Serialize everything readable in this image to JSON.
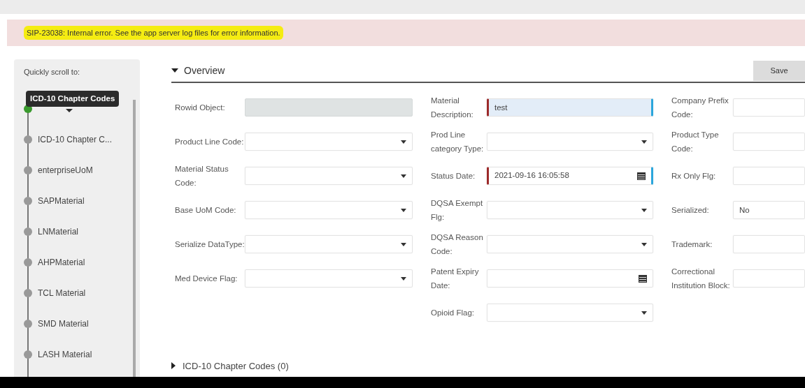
{
  "error_banner": {
    "text": "SIP-23038: Internal error. See the app server log files for error information.",
    "highlighted": true
  },
  "sidebar": {
    "title": "Quickly scroll to:",
    "tooltip": "ICD-10 Chapter Codes",
    "items": [
      {
        "selected": true
      },
      {
        "label": "ICD-10 Chapter C...",
        "selected": false
      },
      {
        "label": "enterpriseUoM",
        "selected": false
      },
      {
        "label": "SAPMaterial",
        "selected": false
      },
      {
        "label": "LNMaterial",
        "selected": false
      },
      {
        "label": "AHPMaterial",
        "selected": false
      },
      {
        "label": "TCL Material",
        "selected": false
      },
      {
        "label": "SMD Material",
        "selected": false
      },
      {
        "label": "LASH Material",
        "selected": false
      }
    ]
  },
  "section": {
    "title": "Overview",
    "expanded": true,
    "save_button": "Save",
    "columns": [
      [
        {
          "label": "Rowid Object:",
          "kind": "text",
          "disabled": true,
          "required": false,
          "focused": false
        },
        {
          "label": "Product Line Code:",
          "kind": "select",
          "disabled": false,
          "required": false,
          "focused": false
        },
        {
          "label": "Material Status Code:",
          "kind": "select",
          "disabled": false,
          "required": false,
          "focused": false
        },
        {
          "label": "Base UoM Code:",
          "kind": "select",
          "disabled": false,
          "required": false,
          "focused": false
        },
        {
          "label": "Serialize DataType:",
          "kind": "select",
          "disabled": false,
          "required": false,
          "focused": false
        },
        {
          "label": "Med Device Flag:",
          "kind": "select",
          "disabled": false,
          "required": false,
          "focused": false
        }
      ],
      [
        {
          "label": "Material Description:",
          "kind": "text",
          "value": "test",
          "disabled": false,
          "required": true,
          "focused": true
        },
        {
          "label": "Prod Line category Type:",
          "kind": "select",
          "disabled": false,
          "required": false,
          "focused": false
        },
        {
          "label": "Status Date:",
          "kind": "date",
          "value": "2021-09-16 16:05:58",
          "disabled": false,
          "required": true,
          "focused": false
        },
        {
          "label": "DQSA Exempt Flg:",
          "kind": "select",
          "disabled": false,
          "required": false,
          "focused": false
        },
        {
          "label": "DQSA Reason Code:",
          "kind": "select",
          "disabled": false,
          "required": false,
          "focused": false
        },
        {
          "label": "Patent Expiry Date:",
          "kind": "date",
          "disabled": false,
          "required": false,
          "focused": false
        },
        {
          "label": "Opioid Flag:",
          "kind": "select",
          "disabled": false,
          "required": false,
          "focused": false
        }
      ],
      [
        {
          "label": "Company Prefix Code:",
          "kind": "text",
          "disabled": false,
          "required": false,
          "focused": false
        },
        {
          "label": "Product Type Code:",
          "kind": "text",
          "disabled": false,
          "required": false,
          "focused": false
        },
        {
          "label": "Rx Only Flg:",
          "kind": "text",
          "disabled": false,
          "required": false,
          "focused": false
        },
        {
          "label": "Serialized:",
          "kind": "text",
          "value": "No",
          "disabled": false,
          "required": false,
          "focused": false
        },
        {
          "label": "Trademark:",
          "kind": "text",
          "disabled": false,
          "required": false,
          "focused": false
        },
        {
          "label": "Correctional Institution Block:",
          "kind": "text",
          "disabled": false,
          "required": false,
          "focused": false
        }
      ]
    ]
  },
  "subsection": {
    "title": "ICD-10 Chapter Codes (0)",
    "expanded": false
  }
}
